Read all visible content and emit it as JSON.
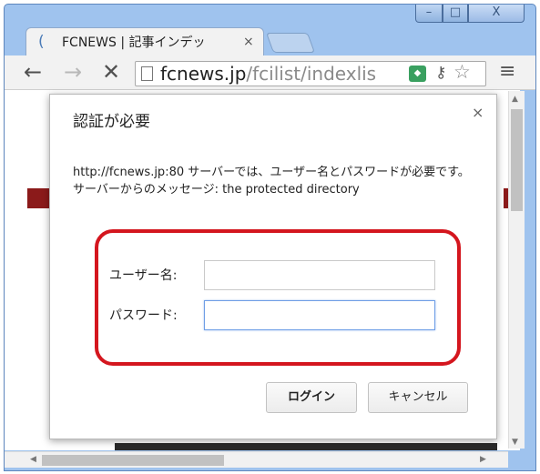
{
  "window": {
    "minimize_glyph": "–",
    "maximize_glyph": "□",
    "close_glyph": "X"
  },
  "tab": {
    "title": "FCNEWS | 記事インデッ",
    "close_glyph": "×"
  },
  "toolbar": {
    "back_glyph": "←",
    "forward_glyph": "→",
    "stop_glyph": "✕",
    "url_host": "fcnews.jp",
    "url_path": "/fcilist/indexlis",
    "menu_glyph": "≡"
  },
  "dialog": {
    "title": "認証が必要",
    "close_glyph": "×",
    "message": "http://fcnews.jp:80 サーバーでは、ユーザー名とパスワードが必要です。サーバーからのメッセージ: the protected directory",
    "username_label": "ユーザー名:",
    "username_value": "",
    "password_label": "パスワード:",
    "password_value": "",
    "login_label": "ログイン",
    "cancel_label": "キャンセル"
  },
  "colors": {
    "highlight": "#d4161e",
    "frame": "#9fc3ee",
    "page_red": "#8b1a1a"
  }
}
